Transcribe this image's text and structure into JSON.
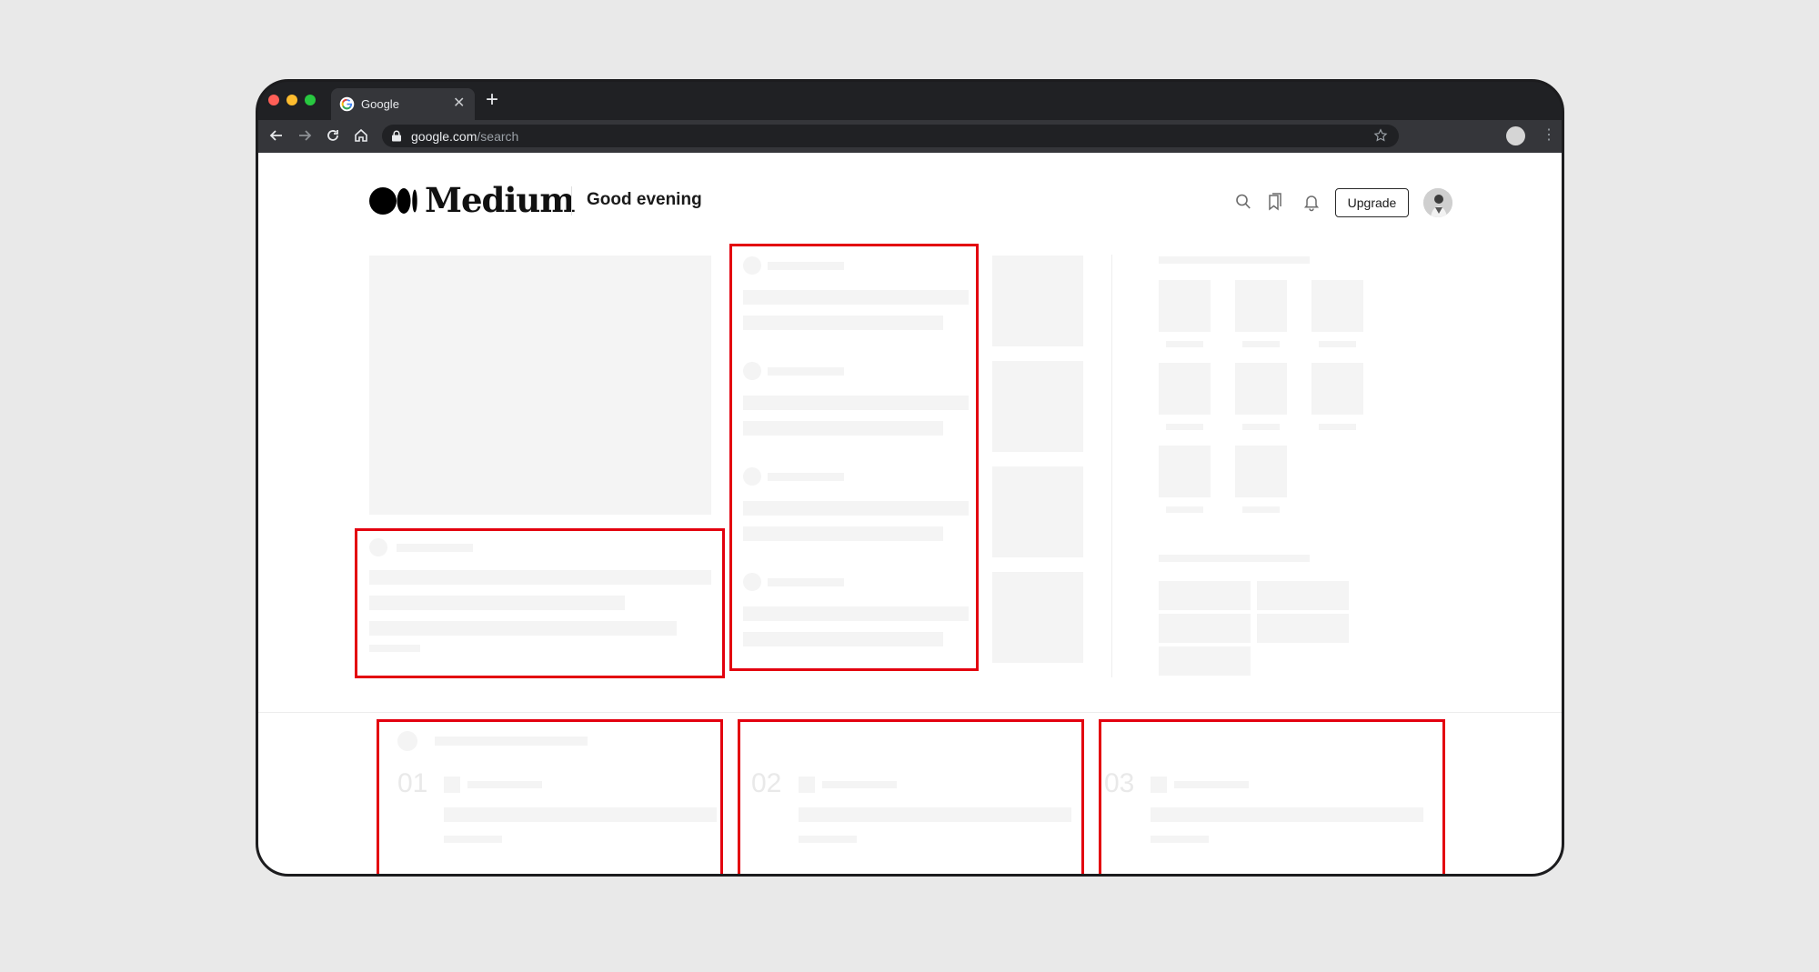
{
  "browser": {
    "tab": {
      "title": "Google",
      "close": "✕",
      "favicon": "google-favicon-icon"
    },
    "new_tab": "+",
    "address": {
      "host": "google.com",
      "path": "/search"
    },
    "menu": "⋮"
  },
  "header": {
    "logo_text": "Medium",
    "greeting": "Good evening",
    "upgrade_label": "Upgrade",
    "icons": [
      "search-icon",
      "bookmarks-icon",
      "notifications-icon"
    ]
  },
  "trending": {
    "ranks": [
      "01",
      "02",
      "03"
    ]
  },
  "colors": {
    "highlight": "#e3000f",
    "skeleton": "#f4f4f4",
    "chrome_dark": "#202124"
  }
}
